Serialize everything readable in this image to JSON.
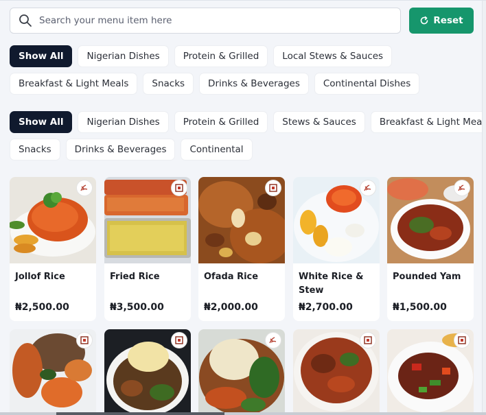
{
  "search": {
    "placeholder": "Search your menu item here",
    "value": ""
  },
  "reset": {
    "label": "Reset",
    "color": "#16966c"
  },
  "filters_primary": [
    [
      "Show All",
      "Nigerian Dishes",
      "Protein & Grilled",
      "Local Stews & Sauces"
    ],
    [
      "Breakfast & Light Meals",
      "Snacks",
      "Drinks & Beverages",
      "Continental Dishes"
    ]
  ],
  "filters_secondary": [
    [
      "Show All",
      "Nigerian Dishes",
      "Protein & Grilled",
      "Stews & Sauces",
      "Breakfast & Light Meals"
    ],
    [
      "Snacks",
      "Drinks & Beverages",
      "Continental"
    ]
  ],
  "active_filter": "Show All",
  "menu_items": [
    {
      "name": "Jollof Rice",
      "price": "₦2,500.00",
      "image_icon": "jollof-rice-photo"
    },
    {
      "name": "Fried Rice",
      "price": "₦3,500.00",
      "image_icon": "fried-rice-photo"
    },
    {
      "name": "Ofada Rice",
      "price": "₦2,000.00",
      "image_icon": "ofada-rice-photo"
    },
    {
      "name": "White Rice & Stew",
      "price": "₦2,700.00",
      "image_icon": "white-rice-stew-photo"
    },
    {
      "name": "Pounded Yam",
      "price": "₦1,500.00",
      "image_icon": "pounded-yam-photo"
    }
  ],
  "menu_items_row2": [
    {
      "image_icon": "amala-photo"
    },
    {
      "image_icon": "fufu-egusi-photo"
    },
    {
      "image_icon": "eba-vegetable-photo"
    },
    {
      "image_icon": "pepper-soup-photo"
    },
    {
      "image_icon": "peppered-meat-photo"
    }
  ]
}
